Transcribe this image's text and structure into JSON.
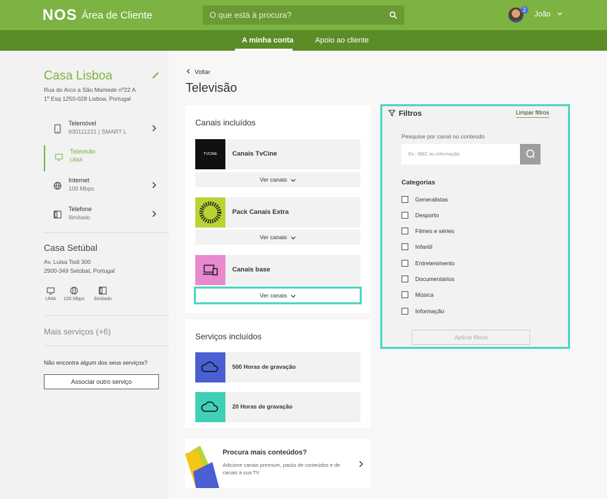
{
  "header": {
    "logo": "NOS",
    "title": "Área de Cliente",
    "search_placeholder": "O que está à procura?",
    "notifications": "2",
    "user": "João"
  },
  "subnav": {
    "tabs": [
      "A minha conta",
      "Apoio ao cliente"
    ]
  },
  "sidebar": {
    "location1": {
      "name": "Casa Lisboa",
      "address_line1": "Rua do Arco a São Mamede nº22 A",
      "address_line2": "1º Esq 1250-028 Lisboa, Portugal"
    },
    "services": [
      {
        "name": "Telemóvel",
        "detail": "930111221 | SMART L"
      },
      {
        "name": "Televisão",
        "detail": "UMA"
      },
      {
        "name": "Internet",
        "detail": "100 Mbps"
      },
      {
        "name": "Telefone",
        "detail": "Ilimitado"
      }
    ],
    "location2": {
      "name": "Casa Setúbal",
      "address_line1": "Av. Luisa Todi 300",
      "address_line2": "2900-349 Setúbal, Portugal",
      "mini": [
        "UMA",
        "100 Mbps",
        "Ilimitado"
      ]
    },
    "more_services": "Mais serviços (+6)",
    "missing_text": "Não encontra algum dos seus serviços?",
    "associate_button": "Associar outro serviço"
  },
  "main": {
    "back": "Voltar",
    "title": "Televisão",
    "channels_card": {
      "title": "Canais incluídos",
      "packages": [
        {
          "name": "Canais TvCine",
          "thumb_text": "TVCINE"
        },
        {
          "name": "Pack Canais Extra"
        },
        {
          "name": "Canais base"
        }
      ],
      "see_channels": "Ver canais"
    },
    "services_card": {
      "title": "Serviços incluídos",
      "items": [
        "500 Horas de gravação",
        "20 Horas de gravação"
      ]
    },
    "promo": {
      "title": "Procura mais conteúdos?",
      "text": "Adicione canais premium, packs de conteúdos e de canais à sua TV"
    }
  },
  "filters": {
    "title": "Filtros",
    "clear": "Limpar filtros",
    "search_label": "Pesquise por canal ou conteúdo",
    "search_placeholder": "Ex.: BBC ou informação",
    "categories_title": "Categorias",
    "categories": [
      "Generalistas",
      "Desporto",
      "Filmes e séries",
      "Infantil",
      "Entretenimento",
      "Documentários",
      "Música",
      "Informação"
    ],
    "apply": "Aplicar filtros"
  },
  "colors": {
    "brand": "#7cb342",
    "brand_dark": "#5b8c25",
    "highlight": "#4fd6c2",
    "tile_blue": "#4a5fd1",
    "tile_teal": "#3fd1b5"
  }
}
